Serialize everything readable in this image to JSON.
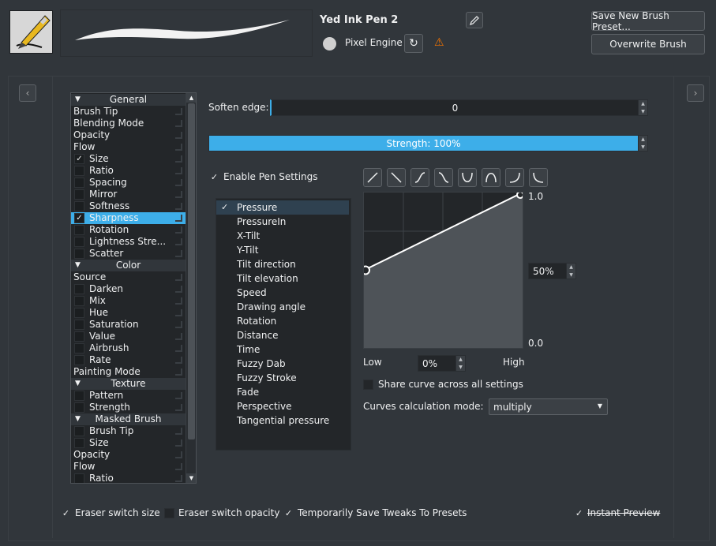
{
  "preset": {
    "name": "Yed Ink Pen 2",
    "engine": "Pixel Engine",
    "save_new_label": "Save New Brush Preset...",
    "overwrite_label": "Overwrite Brush"
  },
  "options": [
    {
      "type": "header",
      "label": "General"
    },
    {
      "type": "item",
      "label": "Brush Tip"
    },
    {
      "type": "item",
      "label": "Blending Mode"
    },
    {
      "type": "item",
      "label": "Opacity"
    },
    {
      "type": "item",
      "label": "Flow"
    },
    {
      "type": "check",
      "label": "Size",
      "checked": true
    },
    {
      "type": "check",
      "label": "Ratio",
      "checked": false
    },
    {
      "type": "check",
      "label": "Spacing",
      "checked": false
    },
    {
      "type": "check",
      "label": "Mirror",
      "checked": false
    },
    {
      "type": "check",
      "label": "Softness",
      "checked": false
    },
    {
      "type": "check",
      "label": "Sharpness",
      "checked": true,
      "selected": true
    },
    {
      "type": "check",
      "label": "Rotation",
      "checked": false
    },
    {
      "type": "check",
      "label": "Lightness Stre...",
      "checked": false
    },
    {
      "type": "check",
      "label": "Scatter",
      "checked": false
    },
    {
      "type": "header",
      "label": "Color"
    },
    {
      "type": "item",
      "label": "Source"
    },
    {
      "type": "check",
      "label": "Darken",
      "checked": false
    },
    {
      "type": "check",
      "label": "Mix",
      "checked": false
    },
    {
      "type": "check",
      "label": "Hue",
      "checked": false
    },
    {
      "type": "check",
      "label": "Saturation",
      "checked": false
    },
    {
      "type": "check",
      "label": "Value",
      "checked": false
    },
    {
      "type": "check",
      "label": "Airbrush",
      "checked": false
    },
    {
      "type": "check",
      "label": "Rate",
      "checked": false
    },
    {
      "type": "item",
      "label": "Painting Mode"
    },
    {
      "type": "header",
      "label": "Texture"
    },
    {
      "type": "check",
      "label": "Pattern",
      "checked": false
    },
    {
      "type": "check",
      "label": "Strength",
      "checked": false
    },
    {
      "type": "header",
      "label": "Masked Brush"
    },
    {
      "type": "check",
      "label": "Brush Tip",
      "checked": false
    },
    {
      "type": "check",
      "label": "Size",
      "checked": false
    },
    {
      "type": "item",
      "label": "Opacity"
    },
    {
      "type": "item",
      "label": "Flow"
    },
    {
      "type": "check",
      "label": "Ratio",
      "checked": false
    }
  ],
  "soften_edge": {
    "label": "Soften edge:",
    "value": "0"
  },
  "strength": {
    "label": "Strength: 100%",
    "value": 1.0
  },
  "enable_pen_settings": {
    "label": "Enable Pen Settings",
    "checked": true
  },
  "sensors": [
    {
      "label": "Pressure",
      "checked": true,
      "selected": true
    },
    {
      "label": "PressureIn",
      "checked": false
    },
    {
      "label": "X-Tilt",
      "checked": false
    },
    {
      "label": "Y-Tilt",
      "checked": false
    },
    {
      "label": "Tilt direction",
      "checked": false
    },
    {
      "label": "Tilt elevation",
      "checked": false
    },
    {
      "label": "Speed",
      "checked": false
    },
    {
      "label": "Drawing angle",
      "checked": false
    },
    {
      "label": "Rotation",
      "checked": false
    },
    {
      "label": "Distance",
      "checked": false
    },
    {
      "label": "Time",
      "checked": false
    },
    {
      "label": "Fuzzy Dab",
      "checked": false
    },
    {
      "label": "Fuzzy Stroke",
      "checked": false
    },
    {
      "label": "Fade",
      "checked": false
    },
    {
      "label": "Perspective",
      "checked": false
    },
    {
      "label": "Tangential pressure",
      "checked": false
    }
  ],
  "curve": {
    "points": [
      [
        0,
        0.5
      ],
      [
        1,
        1
      ]
    ],
    "y_max_label": "1.0",
    "y_min_label": "0.0",
    "mid_value": "50%",
    "low_label": "Low",
    "high_label": "High",
    "low_value": "0%"
  },
  "share_curve": {
    "label": "Share curve across all settings",
    "checked": false
  },
  "curves_mode": {
    "label": "Curves calculation mode:",
    "value": "multiply"
  },
  "bottom": {
    "eraser_size": {
      "label": "Eraser switch size",
      "checked": true
    },
    "eraser_opacity": {
      "label": "Eraser switch opacity",
      "checked": false
    },
    "temp_save": {
      "label": "Temporarily Save Tweaks To Presets",
      "checked": true
    },
    "instant_preview": {
      "label": "Instant Preview",
      "checked": true
    }
  },
  "colors": {
    "accent": "#3daee9",
    "bg": "#31363b",
    "field": "#232629",
    "warning": "#f67400"
  }
}
